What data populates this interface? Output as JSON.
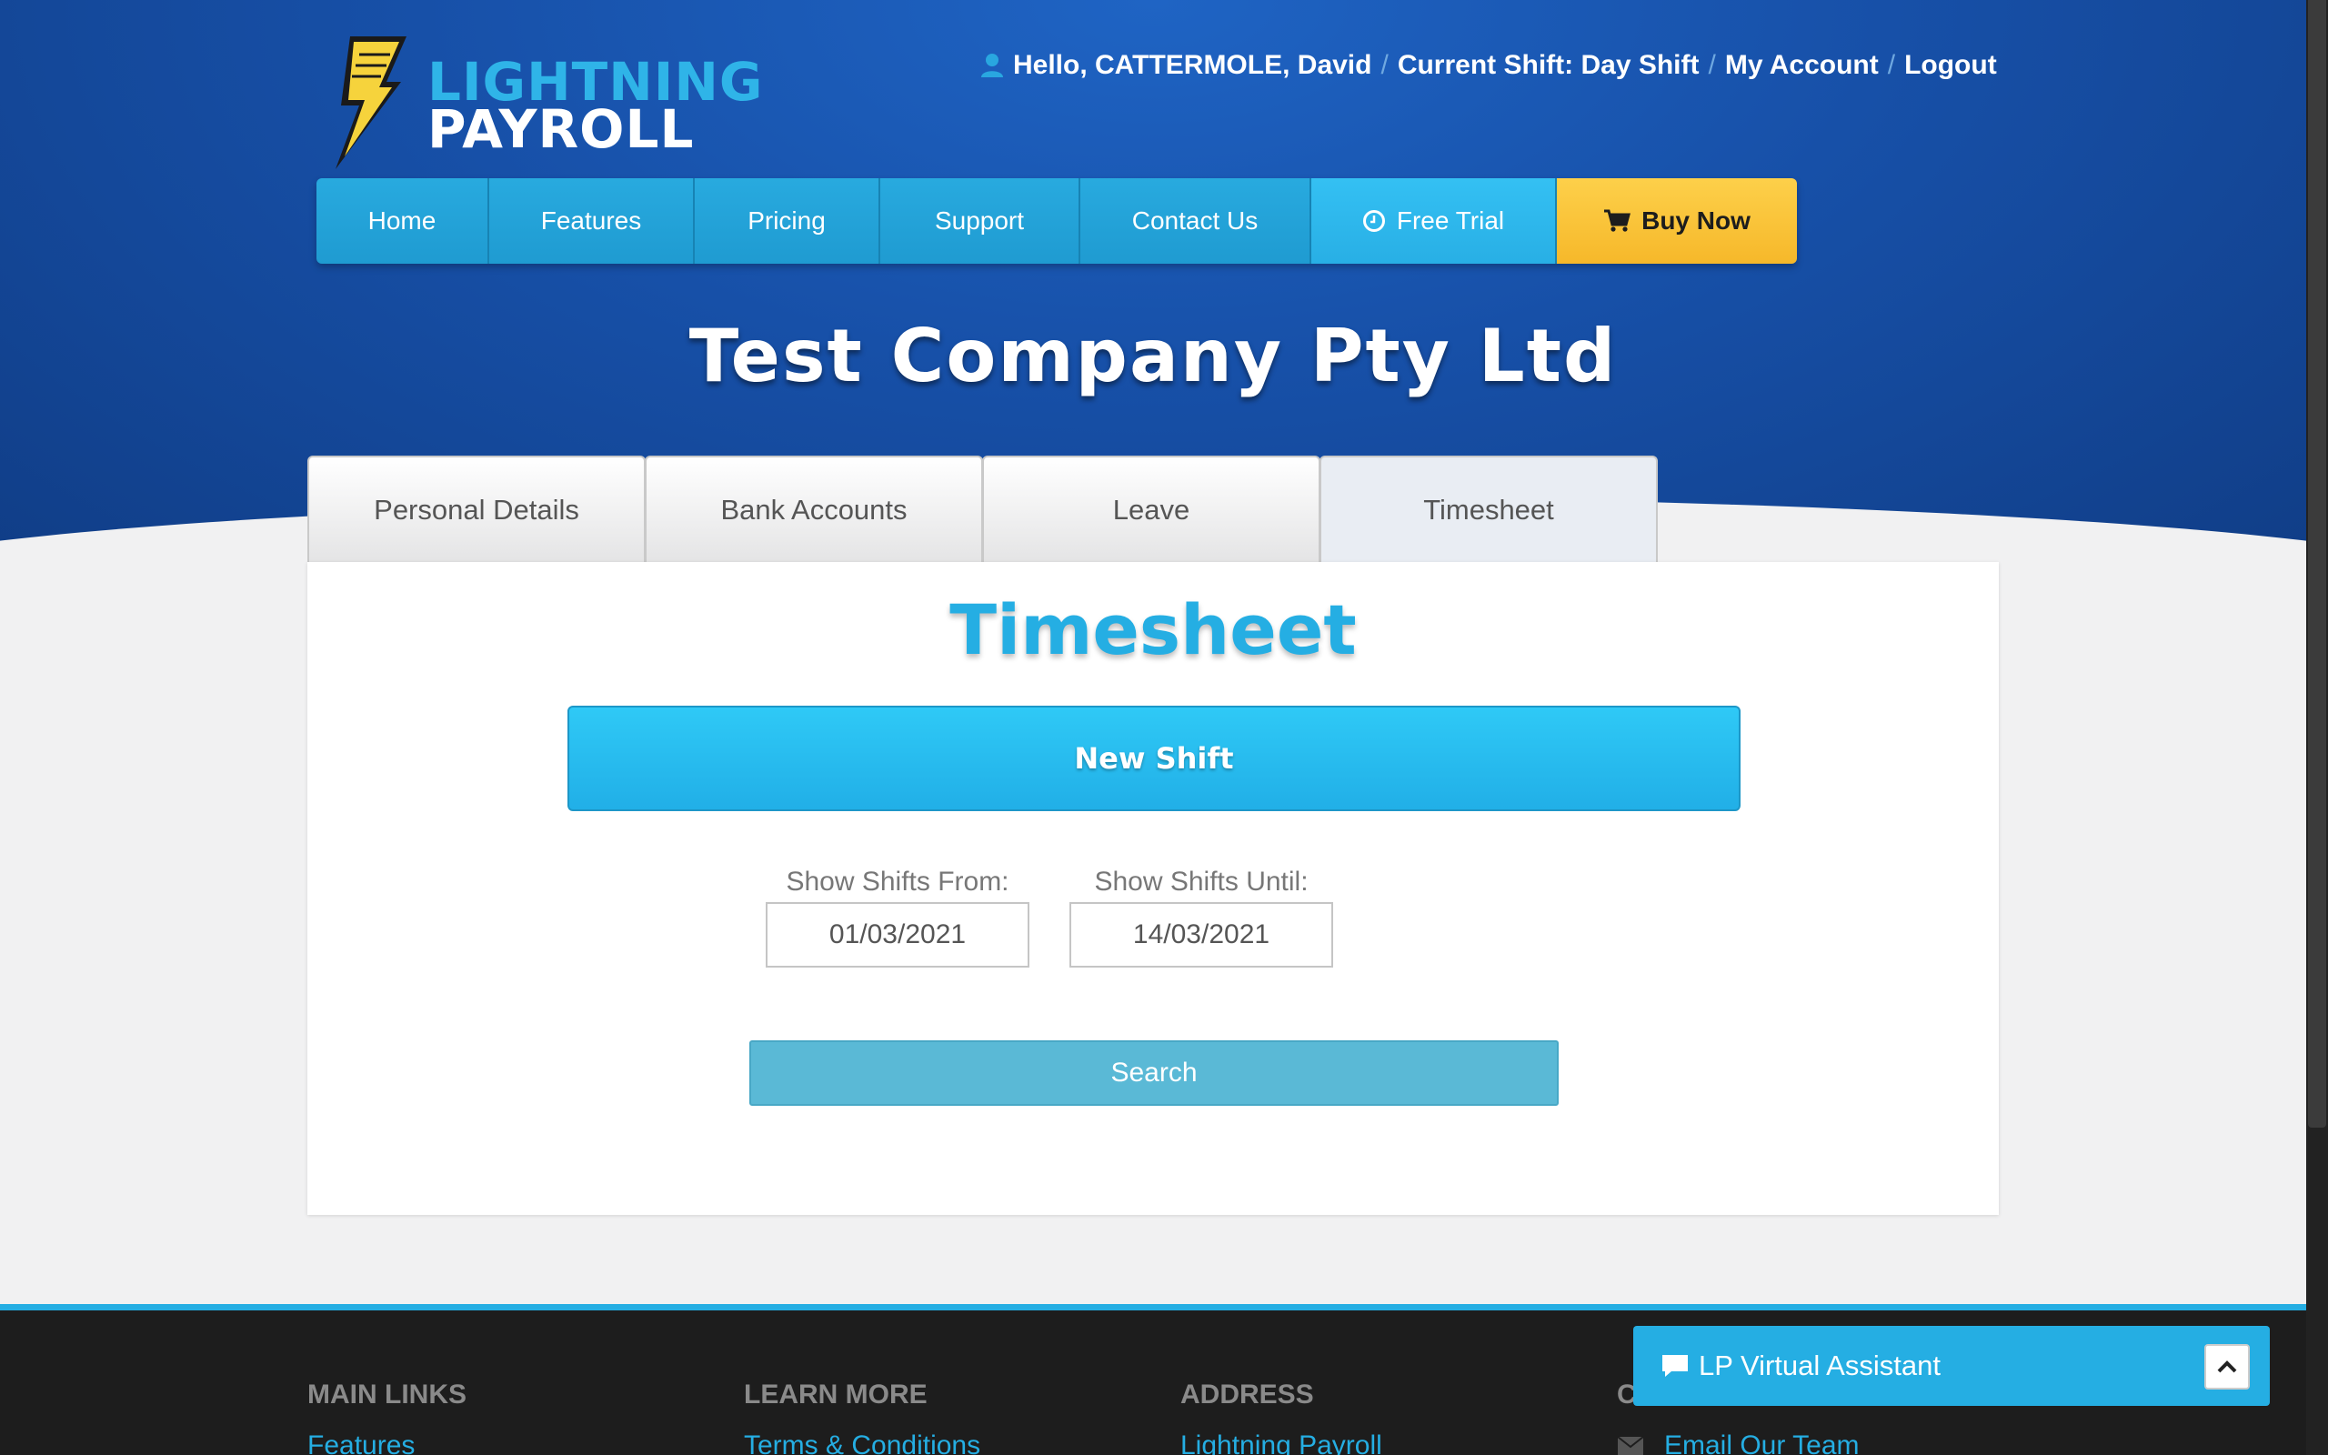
{
  "brand": {
    "line1": "LIGHTNING",
    "line2": "PAYROLL"
  },
  "userbar": {
    "greeting": "Hello, CATTERMOLE, David",
    "shift": "Current Shift: Day Shift",
    "account": "My Account",
    "logout": "Logout",
    "separator": "/"
  },
  "nav": {
    "home": "Home",
    "features": "Features",
    "pricing": "Pricing",
    "support": "Support",
    "contact": "Contact Us",
    "trial": "Free Trial",
    "buy": "Buy Now"
  },
  "company": "Test Company Pty Ltd",
  "tabs": {
    "personal": "Personal Details",
    "bank": "Bank Accounts",
    "leave": "Leave",
    "timesheet": "Timesheet"
  },
  "timesheet": {
    "title": "Timesheet",
    "new_shift": "New Shift",
    "from_label": "Show Shifts From:",
    "from_value": "01/03/2021",
    "until_label": "Show Shifts Until:",
    "until_value": "14/03/2021",
    "search": "Search"
  },
  "footer": {
    "main_links": "MAIN LINKS",
    "main_first": "Features",
    "learn_more": "LEARN MORE",
    "learn_first": "Terms & Conditions",
    "address": "ADDRESS",
    "address_first": "Lightning Payroll",
    "contact_partial": "C",
    "contact_first": "Email Our Team"
  },
  "assistant": {
    "label": "LP Virtual Assistant"
  },
  "colors": {
    "accent": "#25aee3",
    "brand_blue": "#1750a8",
    "buy_yellow": "#f6b82a",
    "footer_bg": "#1d1d1d"
  }
}
